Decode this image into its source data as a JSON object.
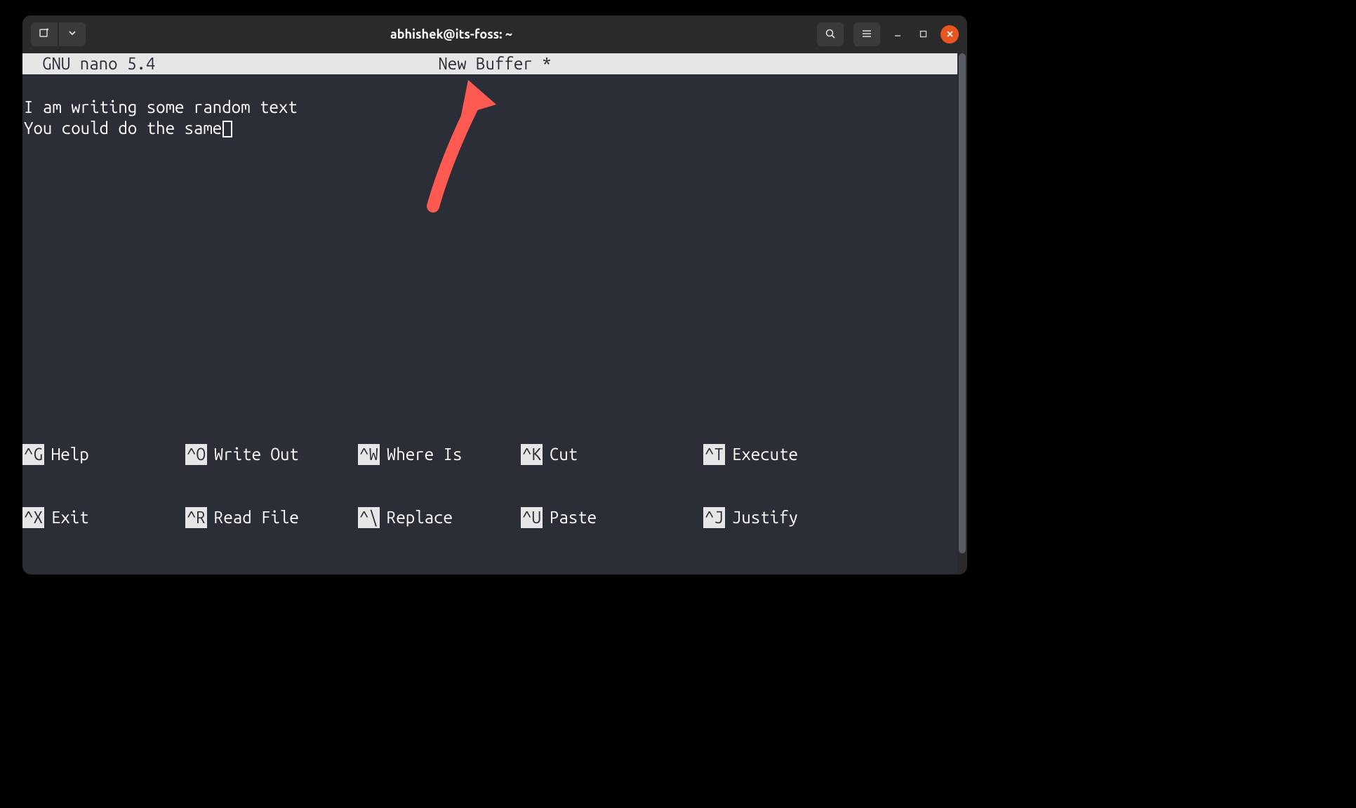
{
  "window": {
    "title": "abhishek@its-foss: ~"
  },
  "nano": {
    "version": "GNU nano 5.4",
    "buffer_label": "New Buffer *",
    "content_line1": "I am writing some random text",
    "content_line2": "You could do the same"
  },
  "shortcuts": {
    "row1": [
      {
        "key": "^G",
        "label": "Help"
      },
      {
        "key": "^O",
        "label": "Write Out"
      },
      {
        "key": "^W",
        "label": "Where Is"
      },
      {
        "key": "^K",
        "label": "Cut"
      },
      {
        "key": "^T",
        "label": "Execute"
      }
    ],
    "row2": [
      {
        "key": "^X",
        "label": "Exit"
      },
      {
        "key": "^R",
        "label": "Read File"
      },
      {
        "key": "^\\",
        "label": "Replace"
      },
      {
        "key": "^U",
        "label": "Paste"
      },
      {
        "key": "^J",
        "label": "Justify"
      }
    ]
  }
}
